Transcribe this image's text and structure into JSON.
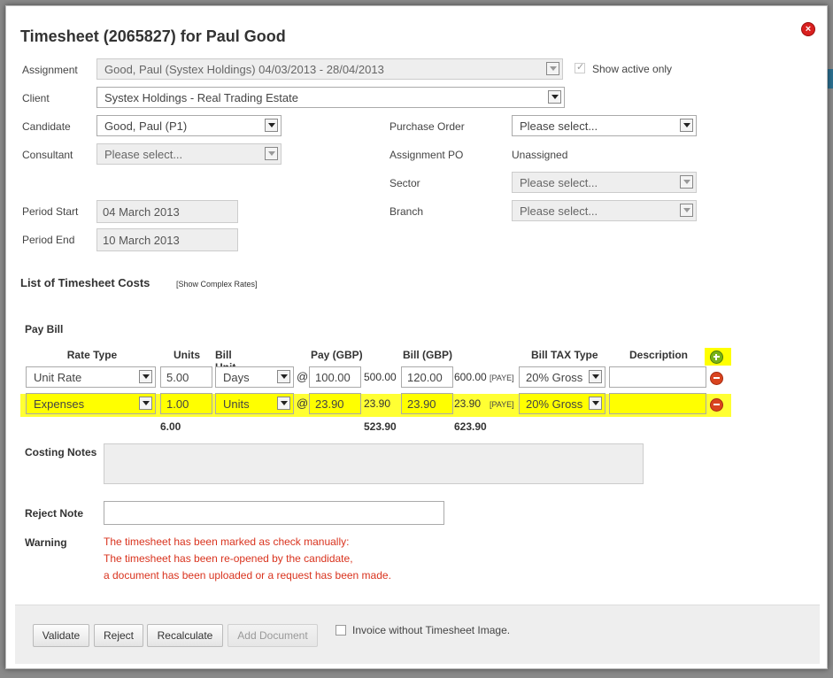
{
  "dialog": {
    "title": "Timesheet (2065827) for Paul Good"
  },
  "form": {
    "assignment_label": "Assignment",
    "assignment_value": "Good, Paul (Systex Holdings) 04/03/2013 - 28/04/2013",
    "show_active_only_label": "Show active only",
    "show_active_only_checked": true,
    "client_label": "Client",
    "client_value": "Systex Holdings - Real Trading Estate",
    "candidate_label": "Candidate",
    "candidate_value": "Good, Paul (P1)",
    "consultant_label": "Consultant",
    "consultant_value": "Please select...",
    "purchase_order_label": "Purchase Order",
    "purchase_order_value": "Please select...",
    "assignment_po_label": "Assignment PO",
    "assignment_po_value": "Unassigned",
    "sector_label": "Sector",
    "sector_value": "Please select...",
    "branch_label": "Branch",
    "branch_value": "Please select...",
    "period_start_label": "Period Start",
    "period_start_value": "04 March 2013",
    "period_end_label": "Period End",
    "period_end_value": "10 March 2013"
  },
  "costs": {
    "section_title": "List of Timesheet Costs",
    "complex_rates_link": "[Show Complex Rates]",
    "pay_bill_label": "Pay Bill",
    "headers": {
      "rate_type": "Rate Type",
      "units": "Units",
      "bill_unit": "Bill Unit",
      "pay": "Pay (GBP)",
      "bill": "Bill (GBP)",
      "bill_tax_type": "Bill TAX Type",
      "description": "Description"
    },
    "rows": [
      {
        "rate_type": "Unit Rate",
        "units": "5.00",
        "bill_unit": "Days",
        "at": "@",
        "pay": "100.00",
        "pay_total": "500.00",
        "bill": "120.00",
        "bill_total": "600.00",
        "paye": "[PAYE]",
        "tax_type": "20% Gross",
        "description": ""
      },
      {
        "rate_type": "Expenses",
        "units": "1.00",
        "bill_unit": "Units",
        "at": "@",
        "pay": "23.90",
        "pay_total": "23.90",
        "bill": "23.90",
        "bill_total": "23.90",
        "paye": "[PAYE]",
        "tax_type": "20% Gross",
        "description": ""
      }
    ],
    "totals": {
      "units": "6.00",
      "pay": "523.90",
      "bill": "623.90"
    },
    "highlight_color": "#ffff00"
  },
  "notes": {
    "costing_notes_label": "Costing Notes",
    "costing_notes_value": "",
    "reject_note_label": "Reject Note",
    "reject_note_value": "",
    "warning_label": "Warning",
    "warning_lines": [
      "The timesheet has been marked as check manually:",
      "The timesheet has been re-opened by the candidate,",
      "a document has been uploaded or a request has been made."
    ],
    "warning_color": "#d9331e"
  },
  "footer": {
    "validate_label": "Validate",
    "reject_label": "Reject",
    "recalculate_label": "Recalculate",
    "add_document_label": "Add Document",
    "invoice_without_image_label": "Invoice without Timesheet Image.",
    "invoice_without_image_checked": false
  }
}
